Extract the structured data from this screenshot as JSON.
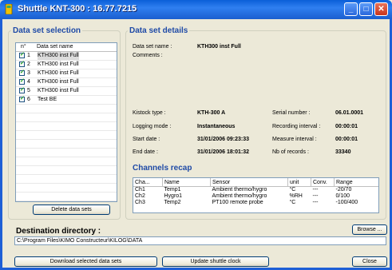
{
  "window": {
    "title": "Shuttle KNT-300 : 16.77.7215"
  },
  "selection": {
    "title": "Data set selection",
    "headers": {
      "num": "n°",
      "name": "Data set name"
    },
    "items": [
      {
        "n": "1",
        "name": "KTH300 inst Full",
        "checked": true
      },
      {
        "n": "2",
        "name": "KTH300 inst Full",
        "checked": true
      },
      {
        "n": "3",
        "name": "KTH300 inst Full",
        "checked": true
      },
      {
        "n": "4",
        "name": "KTH300 inst Full",
        "checked": true
      },
      {
        "n": "5",
        "name": "KTH300 inst Full",
        "checked": true
      },
      {
        "n": "6",
        "name": "Test BE",
        "checked": true
      }
    ],
    "delete_label": "Delete data sets"
  },
  "details": {
    "title": "Data set details",
    "name_label": "Data set name :",
    "name_value": "KTH300 inst Full",
    "comments_label": "Comments :",
    "kistock_label": "Kistock type :",
    "kistock_value": "KTH-300 A",
    "serial_label": "Serial number :",
    "serial_value": "06.01.0001",
    "logging_label": "Logging mode :",
    "logging_value": "Instantaneous",
    "recording_label": "Recording interval :",
    "recording_value": "00:00:01",
    "start_label": "Start date :",
    "start_value": "31/01/2006 09:23:33",
    "measure_label": "Measure interval :",
    "measure_value": "00:00:01",
    "end_label": "End date :",
    "end_value": "31/01/2006 18:01:32",
    "records_label": "Nb of records :",
    "records_value": "33340"
  },
  "channels": {
    "title": "Channels recap",
    "headers": {
      "cha": "Cha...",
      "name": "Name",
      "sensor": "Sensor",
      "unit": "unit",
      "conv": "Conv.",
      "range": "Range"
    },
    "rows": [
      {
        "cha": "Ch1",
        "name": "Temp1",
        "sensor": "Ambient thermo/hygro",
        "unit": "°C",
        "conv": "---",
        "range": "-20/70"
      },
      {
        "cha": "Ch2",
        "name": "Hygro1",
        "sensor": "Ambient thermo/hygro",
        "unit": "%RH",
        "conv": "---",
        "range": "0/100"
      },
      {
        "cha": "Ch3",
        "name": "Temp2",
        "sensor": "PT100 remote probe",
        "unit": "°C",
        "conv": "---",
        "range": "-100/400"
      }
    ]
  },
  "destination": {
    "title": "Destination directory :",
    "path": "C:\\Program Files\\KIMO Constructeur\\KILOG\\DATA",
    "browse_label": "Browse ..."
  },
  "footer": {
    "download_label": "Download selected data sets",
    "update_label": "Update shuttle clock",
    "close_label": "Close"
  }
}
